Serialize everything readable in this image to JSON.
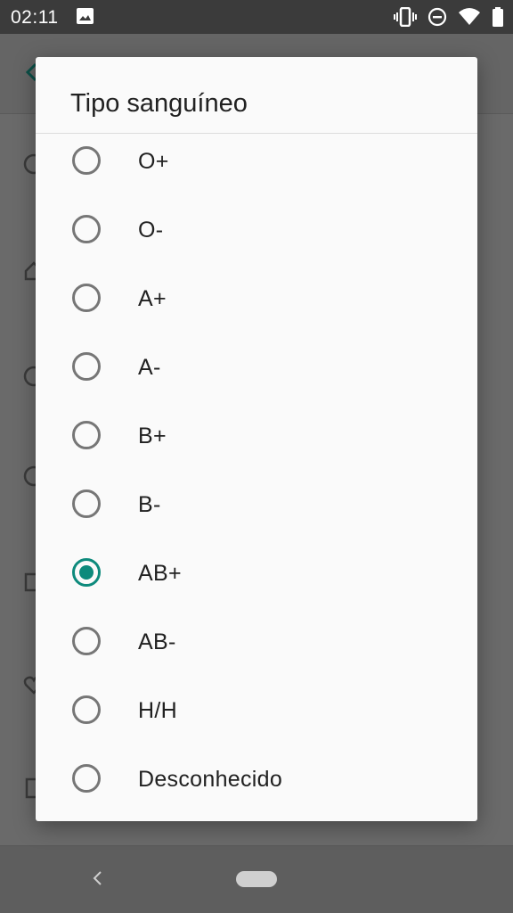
{
  "status_bar": {
    "time": "02:11",
    "icons": [
      "image-icon",
      "vibrate-icon",
      "do-not-disturb-icon",
      "wifi-icon",
      "battery-icon"
    ]
  },
  "dialog": {
    "title": "Tipo sanguíneo",
    "selected": "AB+",
    "options": [
      {
        "label": "O+",
        "checked": false
      },
      {
        "label": "O-",
        "checked": false
      },
      {
        "label": "A+",
        "checked": false
      },
      {
        "label": "A-",
        "checked": false
      },
      {
        "label": "B+",
        "checked": false
      },
      {
        "label": "B-",
        "checked": false
      },
      {
        "label": "AB+",
        "checked": true
      },
      {
        "label": "AB-",
        "checked": false
      },
      {
        "label": "H/H",
        "checked": false
      },
      {
        "label": "Desconhecido",
        "checked": false
      }
    ]
  },
  "nav_bar": {
    "icons": [
      "back-icon",
      "home-pill-icon"
    ]
  },
  "colors": {
    "accent": "#0d8a7c",
    "radio_unchecked": "#767676",
    "scrim": "#6a6a6a",
    "status_bar": "#3b3b3b"
  }
}
